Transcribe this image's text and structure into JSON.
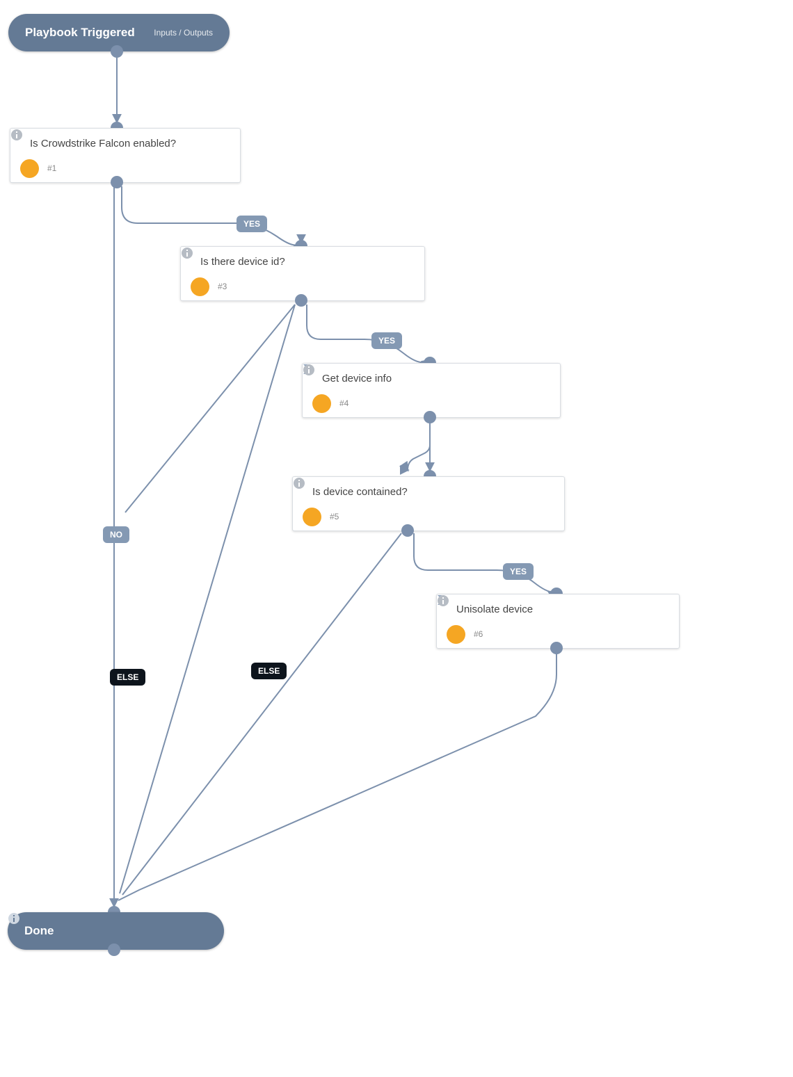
{
  "start": {
    "title": "Playbook Triggered",
    "io": "Inputs / Outputs"
  },
  "done": {
    "title": "Done"
  },
  "nodes": {
    "n1": {
      "title": "Is Crowdstrike Falcon enabled?",
      "step": "#1",
      "shape": "diamond"
    },
    "n3": {
      "title": "Is there device id?",
      "step": "#3",
      "shape": "diamond"
    },
    "n4": {
      "title": "Get device info",
      "step": "#4",
      "shape": "chevron"
    },
    "n5": {
      "title": "Is device contained?",
      "step": "#5",
      "shape": "diamond"
    },
    "n6": {
      "title": "Unisolate device",
      "step": "#6",
      "shape": "chevron"
    }
  },
  "labels": {
    "yes": "YES",
    "no": "NO",
    "else": "ELSE"
  }
}
